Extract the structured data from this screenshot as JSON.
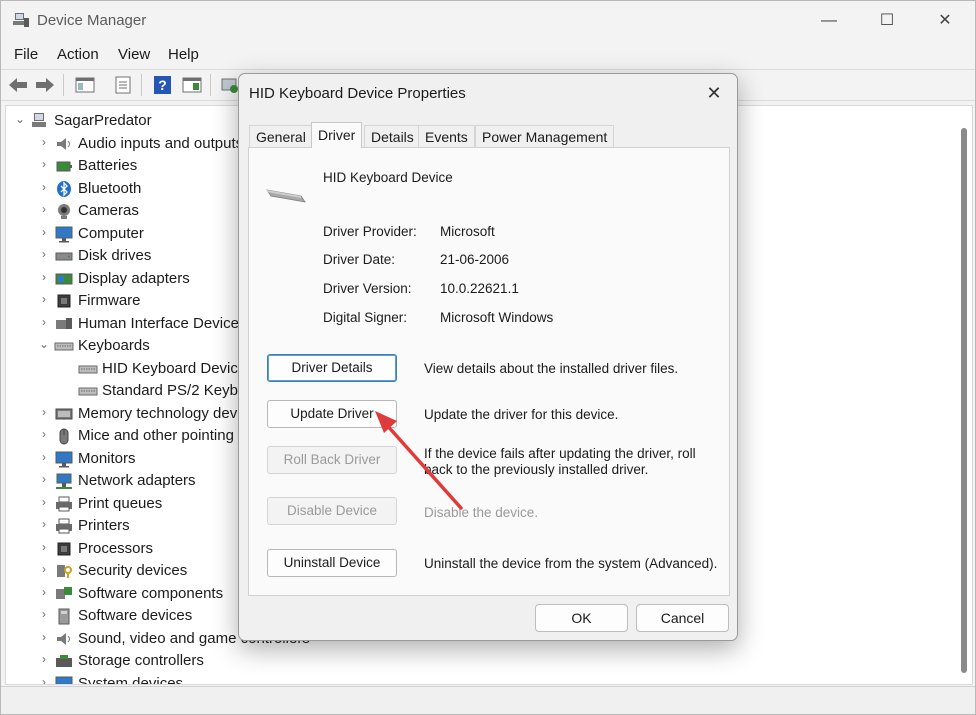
{
  "window": {
    "title": "Device Manager",
    "minimize_icon": "—",
    "maximize_icon": "☐",
    "close_icon": "✕"
  },
  "menu": [
    "File",
    "Action",
    "View",
    "Help"
  ],
  "tree": {
    "root": "SagarPredator",
    "items": [
      {
        "label": "Audio inputs and outputs",
        "icon": "speaker-icon",
        "expanded": false
      },
      {
        "label": "Batteries",
        "icon": "battery-icon",
        "expanded": false
      },
      {
        "label": "Bluetooth",
        "icon": "bluetooth-icon",
        "expanded": false
      },
      {
        "label": "Cameras",
        "icon": "camera-icon",
        "expanded": false
      },
      {
        "label": "Computer",
        "icon": "monitor-icon",
        "expanded": false
      },
      {
        "label": "Disk drives",
        "icon": "disk-icon",
        "expanded": false
      },
      {
        "label": "Display adapters",
        "icon": "display-adapter-icon",
        "expanded": false
      },
      {
        "label": "Firmware",
        "icon": "chip-icon",
        "expanded": false
      },
      {
        "label": "Human Interface Devices",
        "icon": "hid-icon",
        "expanded": false
      },
      {
        "label": "Keyboards",
        "icon": "keyboard-icon",
        "expanded": true
      },
      {
        "label": "HID Keyboard Device",
        "icon": "keyboard-icon",
        "child": true
      },
      {
        "label": "Standard PS/2 Keyboard",
        "icon": "keyboard-icon",
        "child": true
      },
      {
        "label": "Memory technology devices",
        "icon": "memory-icon",
        "expanded": false
      },
      {
        "label": "Mice and other pointing devices",
        "icon": "mouse-icon",
        "expanded": false
      },
      {
        "label": "Monitors",
        "icon": "monitor-icon",
        "expanded": false
      },
      {
        "label": "Network adapters",
        "icon": "network-icon",
        "expanded": false
      },
      {
        "label": "Print queues",
        "icon": "printer-icon",
        "expanded": false
      },
      {
        "label": "Printers",
        "icon": "printer-icon",
        "expanded": false
      },
      {
        "label": "Processors",
        "icon": "chip-icon",
        "expanded": false
      },
      {
        "label": "Security devices",
        "icon": "security-icon",
        "expanded": false
      },
      {
        "label": "Software components",
        "icon": "component-icon",
        "expanded": false
      },
      {
        "label": "Software devices",
        "icon": "device-icon",
        "expanded": false
      },
      {
        "label": "Sound, video and game controllers",
        "icon": "speaker-icon",
        "expanded": false
      },
      {
        "label": "Storage controllers",
        "icon": "storage-icon",
        "expanded": false
      },
      {
        "label": "System devices",
        "icon": "monitor-icon",
        "expanded": false
      }
    ]
  },
  "dialog": {
    "title": "HID Keyboard Device Properties",
    "tabs": [
      "General",
      "Driver",
      "Details",
      "Events",
      "Power Management"
    ],
    "active_tab": "Driver",
    "device_name": "HID Keyboard Device",
    "properties": [
      {
        "label": "Driver Provider:",
        "value": "Microsoft"
      },
      {
        "label": "Driver Date:",
        "value": "21-06-2006"
      },
      {
        "label": "Driver Version:",
        "value": "10.0.22621.1"
      },
      {
        "label": "Digital Signer:",
        "value": "Microsoft Windows"
      }
    ],
    "actions": [
      {
        "button": "Driver Details",
        "description": "View details about the installed driver files.",
        "enabled": true
      },
      {
        "button": "Update Driver",
        "description": "Update the driver for this device.",
        "enabled": true
      },
      {
        "button": "Roll Back Driver",
        "description": "If the device fails after updating the driver, roll back to the previously installed driver.",
        "enabled": false
      },
      {
        "button": "Disable Device",
        "description": "Disable the device.",
        "enabled": false
      },
      {
        "button": "Uninstall Device",
        "description": "Uninstall the device from the system (Advanced).",
        "enabled": true
      }
    ],
    "ok_label": "OK",
    "cancel_label": "Cancel",
    "close_icon": "✕"
  },
  "colors": {
    "annotation_arrow": "#e03a3a",
    "focus_border": "#3c7fb1"
  }
}
